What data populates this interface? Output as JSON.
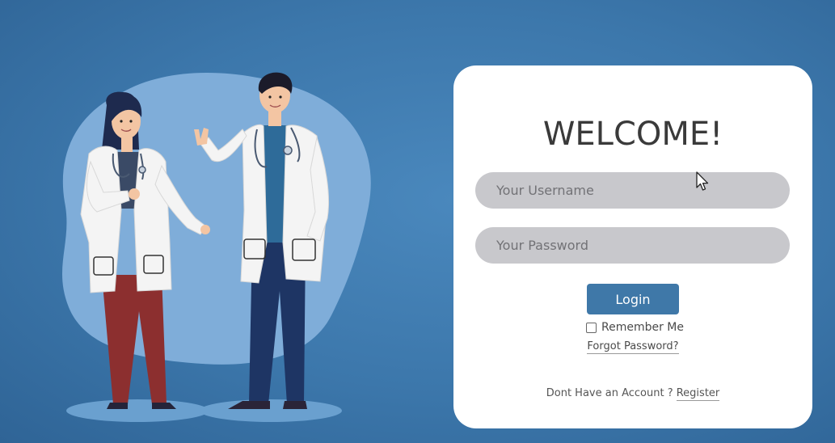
{
  "welcome": {
    "title": "WELCOME!"
  },
  "form": {
    "username_placeholder": "Your Username",
    "password_placeholder": "Your Password",
    "login_label": "Login",
    "remember_label": "Remember Me",
    "forgot_label": "Forgot Password?",
    "no_account_text": "Dont Have an Account ?",
    "register_label": "Register"
  },
  "colors": {
    "background": "#3c77ab",
    "card": "#ffffff",
    "input": "#c8c8cc",
    "button": "#3f78a8"
  },
  "icons": [
    "mouse-cursor-icon",
    "checkbox-icon"
  ]
}
